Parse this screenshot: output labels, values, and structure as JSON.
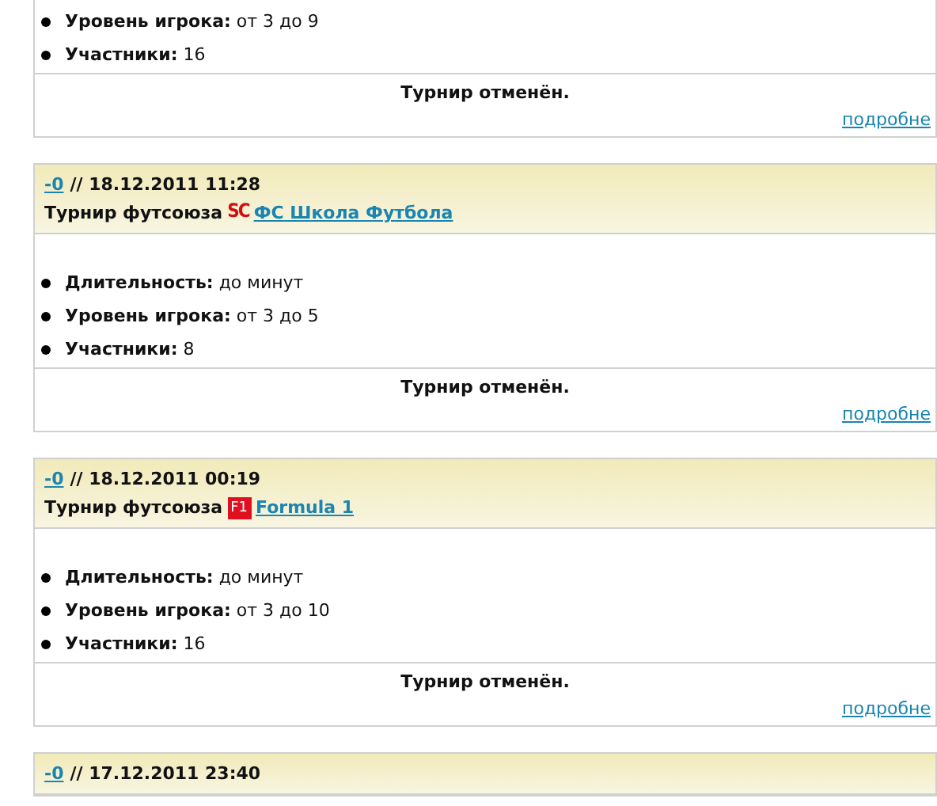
{
  "tournaments": [
    {
      "details": [
        {
          "label": "Уровень игрока:",
          "value": "от 3 до 9"
        },
        {
          "label": "Участники:",
          "value": "16"
        }
      ],
      "status": "Турнир отменён.",
      "more_link": "подробне"
    },
    {
      "header": {
        "score_link": "-0",
        "datetime": "// 18.12.2011 11:28",
        "type": "Турнир футсоюза",
        "badge": {
          "kind": "letters",
          "text": "SC"
        },
        "team_link": "ФС Школа Футбола"
      },
      "details": [
        {
          "label": "Длительность:",
          "value": "до минут"
        },
        {
          "label": "Уровень игрока:",
          "value": "от 3 до 5"
        },
        {
          "label": "Участники:",
          "value": "8"
        }
      ],
      "status": "Турнир отменён.",
      "more_link": "подробне"
    },
    {
      "header": {
        "score_link": "-0",
        "datetime": "// 18.12.2011 00:19",
        "type": "Турнир футсоюза",
        "badge": {
          "kind": "boxed",
          "text": "F1"
        },
        "team_link": "Formula 1"
      },
      "details": [
        {
          "label": "Длительность:",
          "value": "до минут"
        },
        {
          "label": "Уровень игрока:",
          "value": "от 3 до 10"
        },
        {
          "label": "Участники:",
          "value": "16"
        }
      ],
      "status": "Турнир отменён.",
      "more_link": "подробне"
    },
    {
      "header": {
        "score_link": "-0",
        "datetime": "// 17.12.2011 23:40"
      }
    }
  ]
}
